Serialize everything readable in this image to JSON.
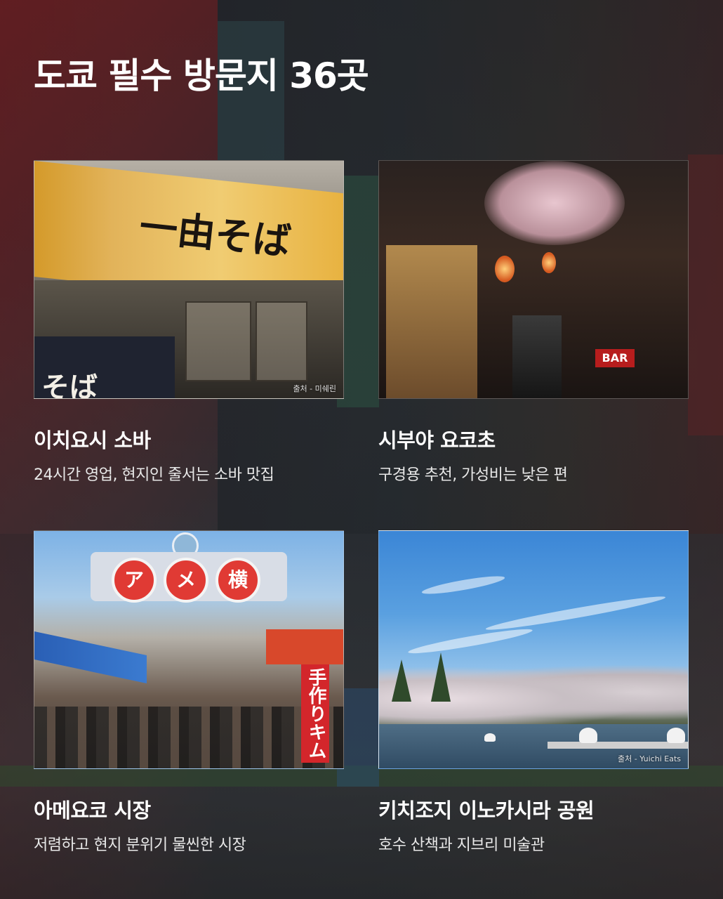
{
  "page": {
    "title": "도쿄 필수 방문지 36곳"
  },
  "cards": [
    {
      "title": "이치요시 소바",
      "description": "24시간 영업, 현지인 줄서는 소바 맛집",
      "photo_credit": "출처 - 미쉐린",
      "sign_text": "一由そば",
      "noren_text": "そば"
    },
    {
      "title": "시부야 요코초",
      "description": "구경용 추천, 가성비는 낮은 편",
      "photo_credit": "",
      "bar_sign": "BAR"
    },
    {
      "title": "아메요코 시장",
      "description": "저렴하고 현지 분위기 물씬한 시장",
      "photo_credit": "",
      "arch_chars": [
        "ア",
        "メ",
        "横"
      ],
      "banner_text": "手作りキム"
    },
    {
      "title": "키치조지 이노카시라 공원",
      "description": "호수 산책과 지브리 미술관",
      "photo_credit": "출처 - Yuichi Eats"
    }
  ]
}
